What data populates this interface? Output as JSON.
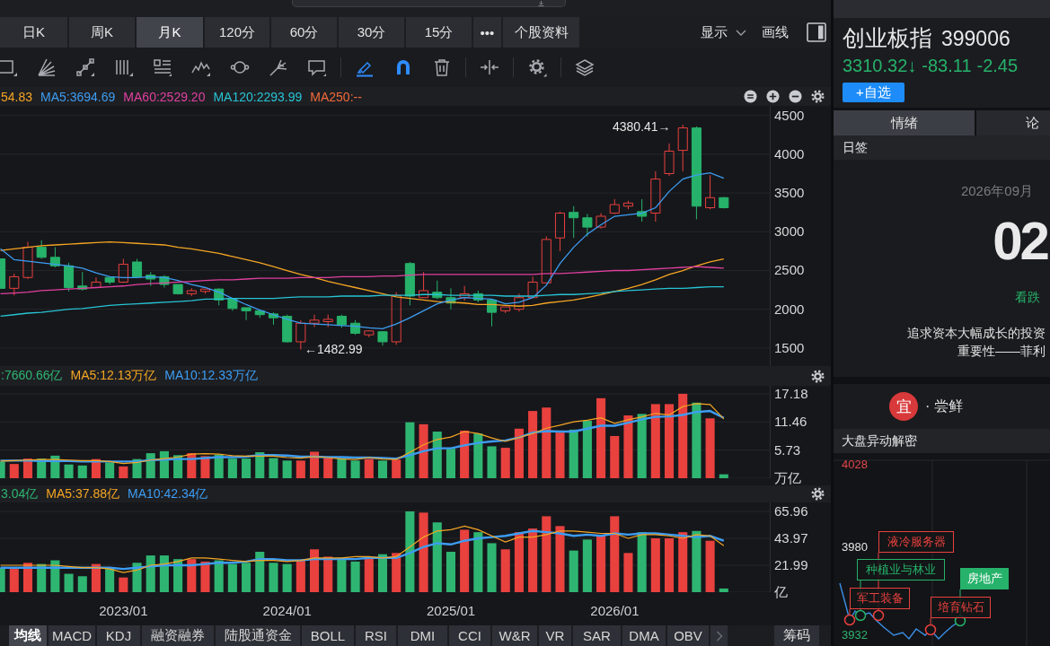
{
  "period_tabs": [
    {
      "label": "日K",
      "selected": false
    },
    {
      "label": "周K",
      "selected": false
    },
    {
      "label": "月K",
      "selected": true
    },
    {
      "label": "120分",
      "selected": false
    },
    {
      "label": "60分",
      "selected": false
    },
    {
      "label": "30分",
      "selected": false
    },
    {
      "label": "15分",
      "selected": false
    },
    {
      "label": "•••",
      "selected": false
    },
    {
      "label": "个股资料",
      "selected": false
    }
  ],
  "view_controls": [
    {
      "label": "显示",
      "kind": "dropdown"
    },
    {
      "label": "画线",
      "kind": "button"
    }
  ],
  "drawing_tools": [
    {
      "kind": "rectangle",
      "active": false
    },
    {
      "kind": "fan",
      "active": false
    },
    {
      "kind": "segment",
      "active": false
    },
    {
      "kind": "cycle_lines",
      "active": false
    },
    {
      "kind": "text_lines",
      "active": false
    },
    {
      "kind": "wave",
      "active": false
    },
    {
      "kind": "ellipse",
      "active": false
    },
    {
      "kind": "pitchfork",
      "active": false
    },
    {
      "kind": "note",
      "active": false
    },
    {
      "kind": "highlighter",
      "active": true
    },
    {
      "kind": "magnet",
      "active": true
    },
    {
      "kind": "delete",
      "active": false
    },
    {
      "kind": "measure",
      "active": false
    },
    {
      "kind": "settings",
      "active": false
    },
    {
      "kind": "layers",
      "active": false
    }
  ],
  "price_chart": {
    "chart_data": {
      "type": "candlestick",
      "categories": [
        null,
        null,
        null,
        null,
        null,
        null,
        null,
        null,
        null,
        null,
        null,
        null,
        null,
        null,
        null,
        null,
        null,
        null,
        null,
        null,
        null,
        null,
        null,
        null,
        null,
        null,
        null,
        null,
        null,
        null,
        null,
        null,
        null,
        null,
        null,
        null,
        null,
        null,
        null,
        null,
        null,
        null,
        null,
        null,
        null,
        null,
        null,
        null,
        null,
        null,
        null,
        null,
        null,
        null
      ],
      "ohlc": [
        [
          2650,
          2650,
          2270,
          2270
        ],
        [
          2270,
          2460,
          2180,
          2420
        ],
        [
          2410,
          2870,
          2390,
          2800
        ],
        [
          2800,
          2890,
          2650,
          2670
        ],
        [
          2670,
          2800,
          2540,
          2560
        ],
        [
          2560,
          2600,
          2230,
          2280
        ],
        [
          2300,
          2480,
          2240,
          2260
        ],
        [
          2280,
          2410,
          2280,
          2350
        ],
        [
          2410,
          2410,
          2320,
          2350
        ],
        [
          2350,
          2650,
          2340,
          2580
        ],
        [
          2610,
          2650,
          2420,
          2420
        ],
        [
          2440,
          2480,
          2300,
          2390
        ],
        [
          2420,
          2440,
          2280,
          2320
        ],
        [
          2320,
          2320,
          2190,
          2200
        ],
        [
          2200,
          2270,
          2170,
          2240
        ],
        [
          2230,
          2260,
          2200,
          2260
        ],
        [
          2260,
          2270,
          2050,
          2120
        ],
        [
          2130,
          2130,
          1980,
          2010
        ],
        [
          2020,
          2020,
          1860,
          1980
        ],
        [
          1980,
          1980,
          1890,
          1930
        ],
        [
          1940,
          1960,
          1800,
          1890
        ],
        [
          1910,
          1930,
          1570,
          1580
        ],
        [
          1580,
          1860,
          1480,
          1820
        ],
        [
          1820,
          1930,
          1770,
          1860
        ],
        [
          1840,
          1930,
          1770,
          1870
        ],
        [
          1910,
          1930,
          1760,
          1800
        ],
        [
          1820,
          1860,
          1670,
          1690
        ],
        [
          1670,
          1730,
          1640,
          1720
        ],
        [
          1710,
          1720,
          1530,
          1580
        ],
        [
          1580,
          2220,
          1540,
          2180
        ],
        [
          2590,
          2610,
          2050,
          2170
        ],
        [
          2150,
          2480,
          2150,
          2240
        ],
        [
          2220,
          2370,
          2130,
          2150
        ],
        [
          2150,
          2270,
          2000,
          2080
        ],
        [
          2150,
          2300,
          2110,
          2200
        ],
        [
          2200,
          2240,
          2090,
          2120
        ],
        [
          2120,
          2120,
          1780,
          1960
        ],
        [
          1980,
          2030,
          1950,
          2030
        ],
        [
          2000,
          2200,
          1970,
          2150
        ],
        [
          2150,
          2420,
          2150,
          2350
        ],
        [
          2340,
          2940,
          2340,
          2900
        ],
        [
          2920,
          3260,
          2750,
          3240
        ],
        [
          3250,
          3330,
          2920,
          3180
        ],
        [
          3180,
          3230,
          2940,
          3060
        ],
        [
          3060,
          3240,
          3040,
          3200
        ],
        [
          3240,
          3420,
          3230,
          3350
        ],
        [
          3330,
          3400,
          3290,
          3370
        ],
        [
          3260,
          3420,
          3130,
          3200
        ],
        [
          3240,
          3780,
          3130,
          3680
        ],
        [
          3750,
          4140,
          3720,
          4040
        ],
        [
          4050,
          4380,
          3780,
          4340
        ],
        [
          4340,
          4360,
          3160,
          3330
        ],
        [
          3310,
          3730,
          3290,
          3440
        ],
        [
          3440,
          3450,
          3300,
          3310
        ]
      ],
      "series": [
        {
          "name": "54.83",
          "type": "line",
          "color": "#f5a623",
          "values": [
            2760,
            2780,
            2800,
            2820,
            2830,
            2840,
            2850,
            2860,
            2870,
            2860,
            2850,
            2840,
            2830,
            2800,
            2780,
            2750,
            2720,
            2680,
            2640,
            2600,
            2550,
            2500,
            2450,
            2410,
            2360,
            2320,
            2280,
            2240,
            2200,
            2160,
            2140,
            2120,
            2100,
            2090,
            2080,
            2060,
            2060,
            2050,
            2040,
            2050,
            2080,
            2100,
            2120,
            2150,
            2190,
            2230,
            2270,
            2320,
            2380,
            2450,
            2500,
            2560,
            2610,
            2650
          ]
        },
        {
          "name": "MA5:3694.69",
          "type": "line",
          "color": "#3d9df2",
          "values": [
            2780,
            2640,
            2620,
            2600,
            2580,
            2560,
            2530,
            2470,
            2420,
            2410,
            2410,
            2420,
            2410,
            2370,
            2320,
            2280,
            2220,
            2140,
            2060,
            1990,
            1930,
            1870,
            1820,
            1810,
            1800,
            1790,
            1780,
            1760,
            1750,
            1810,
            1890,
            1980,
            2070,
            2120,
            2150,
            2140,
            2130,
            2070,
            2090,
            2150,
            2310,
            2590,
            2800,
            2970,
            3090,
            3200,
            3220,
            3240,
            3310,
            3520,
            3680,
            3730,
            3760,
            3690
          ]
        },
        {
          "name": "MA60:2529.20",
          "type": "line",
          "color": "#e0409f",
          "values": [
            2200,
            2210,
            2220,
            2240,
            2250,
            2260,
            2270,
            2280,
            2290,
            2300,
            2320,
            2330,
            2340,
            2350,
            2360,
            2370,
            2380,
            2380,
            2390,
            2400,
            2400,
            2400,
            2410,
            2410,
            2410,
            2420,
            2420,
            2420,
            2430,
            2430,
            2440,
            2450,
            2450,
            2450,
            2450,
            2450,
            2450,
            2450,
            2450,
            2450,
            2460,
            2460,
            2470,
            2480,
            2490,
            2500,
            2500,
            2510,
            2520,
            2530,
            2540,
            2550,
            2540,
            2530
          ]
        },
        {
          "name": "MA120:2293.99",
          "type": "line",
          "color": "#27c4d4",
          "values": [
            1910,
            1930,
            1950,
            1960,
            1980,
            2000,
            2010,
            2030,
            2050,
            2060,
            2070,
            2080,
            2090,
            2100,
            2110,
            2130,
            2130,
            2140,
            2140,
            2140,
            2140,
            2150,
            2160,
            2160,
            2160,
            2170,
            2170,
            2170,
            2180,
            2180,
            2180,
            2190,
            2190,
            2180,
            2180,
            2180,
            2180,
            2170,
            2170,
            2170,
            2180,
            2190,
            2190,
            2200,
            2210,
            2230,
            2240,
            2250,
            2260,
            2270,
            2270,
            2280,
            2290,
            2290
          ]
        },
        {
          "name": "MA250:--",
          "type": "line",
          "color": "#f26b3a",
          "values": [
            null,
            null,
            null,
            null,
            null,
            null,
            null,
            null,
            null,
            null,
            null,
            null,
            null,
            null,
            null,
            null,
            null,
            null,
            null,
            null,
            null,
            null,
            null,
            null,
            null,
            null,
            null,
            null,
            null,
            null,
            null,
            null,
            null,
            null,
            null,
            null,
            null,
            null,
            null,
            null,
            null,
            null,
            null,
            null,
            null,
            null,
            null,
            null,
            null,
            null,
            null,
            null,
            null,
            null
          ]
        }
      ],
      "ylim": [
        1267,
        4624
      ],
      "yticks": [
        4500,
        4000,
        3500,
        3000,
        2500,
        2000,
        1500
      ],
      "grid": true,
      "annotations": [
        "4380.41→",
        "←1482.99"
      ]
    }
  },
  "turnover_chart": {
    "chart_data": {
      "type": "bar",
      "stacked": true,
      "categories": [
        null,
        null,
        null,
        null,
        null,
        null,
        null,
        null,
        null,
        null,
        null,
        null,
        null,
        null,
        null,
        null,
        null,
        null,
        null,
        null,
        null,
        null,
        null,
        null,
        null,
        null,
        null,
        null,
        null,
        null,
        null,
        null,
        null,
        null,
        null,
        null,
        null,
        null,
        null,
        null,
        null,
        null,
        null,
        null,
        null,
        null,
        null,
        null,
        null,
        null,
        null,
        null,
        null,
        null
      ],
      "series": [
        {
          "name": ":7660.66亿",
          "color": "#2fb572",
          "values": [
            3.4,
            null,
            null,
            4.0,
            4.6,
            2.8,
            2.6,
            null,
            3.2,
            null,
            3.9,
            5.1,
            5.5,
            4.7,
            null,
            null,
            4.8,
            4.0,
            4.0,
            5.3,
            4.1,
            3.6,
            null,
            null,
            null,
            4.1,
            3.6,
            null,
            3.6,
            null,
            11.4,
            null,
            9.5,
            6.0,
            null,
            9.1,
            6.5,
            null,
            null,
            null,
            null,
            null,
            9.9,
            11.7,
            null,
            null,
            null,
            13.1,
            null,
            null,
            null,
            15.4,
            null,
            0.8
          ]
        },
        {
          "color": "#e8413e",
          "values": [
            null,
            2.9,
            4.0,
            null,
            null,
            null,
            null,
            3.9,
            null,
            2.4,
            null,
            null,
            null,
            null,
            5.1,
            4.5,
            null,
            null,
            null,
            null,
            null,
            null,
            3.6,
            5.4,
            4.1,
            null,
            null,
            3.9,
            null,
            3.8,
            null,
            11.0,
            null,
            null,
            9.7,
            null,
            null,
            6.2,
            10.1,
            13.7,
            14.4,
            9.3,
            null,
            null,
            16.3,
            8.6,
            12.8,
            null,
            15.1,
            15.1,
            17.2,
            null,
            12.2,
            null
          ]
        },
        {
          "name": "MA5:12.13万亿",
          "type": "line",
          "color": "#f5a623",
          "values": [
            3.5,
            3.6,
            3.7,
            3.8,
            3.8,
            3.7,
            3.6,
            3.6,
            3.4,
            3.0,
            3.2,
            3.7,
            4.0,
            4.3,
            4.9,
            5.0,
            4.9,
            4.6,
            4.5,
            4.5,
            4.5,
            4.2,
            4.1,
            4.4,
            4.2,
            3.9,
            3.8,
            4.2,
            3.9,
            3.8,
            5.3,
            6.8,
            7.9,
            8.4,
            9.5,
            9.1,
            8.2,
            7.5,
            8.3,
            9.1,
            10.2,
            10.8,
            11.5,
            11.8,
            12.3,
            11.2,
            11.9,
            12.5,
            13.2,
            12.9,
            14.6,
            15.2,
            15.0,
            12.1
          ]
        },
        {
          "name": "MA10:12.33万亿",
          "type": "line",
          "color": "#3d9df2",
          "values": [
            3.6,
            3.6,
            3.6,
            3.5,
            3.5,
            3.5,
            3.4,
            3.4,
            3.4,
            3.4,
            3.4,
            3.7,
            3.8,
            3.9,
            3.9,
            4.1,
            4.3,
            4.3,
            4.4,
            4.7,
            4.7,
            4.6,
            4.4,
            4.4,
            4.3,
            4.3,
            4.2,
            4.2,
            4.1,
            4.0,
            4.7,
            5.5,
            6.1,
            6.1,
            6.7,
            7.2,
            7.5,
            7.7,
            8.3,
            9.3,
            9.6,
            9.5,
            9.5,
            10.1,
            10.7,
            10.7,
            11.3,
            12.0,
            12.5,
            12.6,
            12.9,
            13.5,
            13.7,
            12.3
          ]
        }
      ],
      "ylim": [
        0,
        18.83
      ],
      "yticks": [
        17.18,
        11.46,
        5.73,
        {
          "value": 0,
          "label": "万亿"
        }
      ],
      "grid": true
    }
  },
  "volume_chart": {
    "chart_data": {
      "type": "bar",
      "stacked": true,
      "categories": [
        null,
        null,
        null,
        null,
        null,
        null,
        null,
        null,
        null,
        "2023/01",
        null,
        null,
        null,
        null,
        null,
        null,
        null,
        null,
        null,
        null,
        null,
        "2024/01",
        null,
        null,
        null,
        null,
        null,
        null,
        null,
        null,
        null,
        null,
        null,
        "2025/01",
        null,
        null,
        null,
        null,
        null,
        null,
        null,
        null,
        null,
        null,
        null,
        "2026/01",
        null,
        null,
        null,
        null,
        null,
        null,
        null,
        null
      ],
      "series": [
        {
          "name": "3.04亿",
          "color": "#2fb572",
          "values": [
            20,
            null,
            null,
            23,
            26,
            15,
            13,
            null,
            19,
            null,
            24,
            30,
            30,
            27,
            null,
            null,
            26,
            23,
            24,
            33,
            24,
            23,
            null,
            null,
            null,
            28,
            25,
            null,
            31,
            null,
            66,
            null,
            57,
            33,
            null,
            49,
            40,
            null,
            null,
            null,
            null,
            null,
            34,
            43,
            null,
            null,
            null,
            49,
            null,
            null,
            null,
            50,
            null,
            3
          ]
        },
        {
          "color": "#e8413e",
          "values": [
            null,
            19,
            24,
            null,
            null,
            null,
            null,
            23,
            null,
            12,
            null,
            null,
            null,
            null,
            27,
            25,
            null,
            null,
            null,
            null,
            null,
            null,
            26,
            35,
            29,
            null,
            null,
            28,
            null,
            32,
            null,
            65,
            null,
            null,
            51,
            null,
            null,
            35,
            49,
            52,
            62,
            54,
            null,
            null,
            47,
            62,
            32,
            null,
            44,
            44,
            49,
            null,
            42,
            null
          ]
        },
        {
          "name": "MA5:37.88亿",
          "type": "line",
          "color": "#f5a623",
          "values": [
            22,
            22,
            22,
            22,
            22,
            21,
            20,
            20,
            19,
            16,
            18,
            22,
            23,
            25,
            28,
            28,
            27,
            26,
            25,
            26,
            26,
            25,
            26,
            28,
            28,
            28,
            29,
            29,
            28,
            29,
            37,
            45,
            50,
            51,
            54,
            51,
            46,
            41,
            45,
            45,
            47,
            50,
            50,
            49,
            48,
            48,
            44,
            47,
            47,
            46,
            44,
            47,
            46,
            38
          ]
        },
        {
          "name": "MA10:42.34亿",
          "type": "line",
          "color": "#3d9df2",
          "values": [
            20,
            20,
            20,
            20,
            20,
            20,
            20,
            20,
            20,
            19,
            20,
            21,
            22,
            22,
            22,
            23,
            24,
            24,
            25,
            27,
            27,
            26,
            26,
            27,
            27,
            27,
            27,
            28,
            28,
            28,
            32,
            37,
            40,
            39,
            42,
            44,
            45,
            46,
            48,
            50,
            49,
            48,
            46,
            47,
            46,
            48,
            47,
            48,
            48,
            47,
            46,
            45,
            46,
            42
          ]
        }
      ],
      "ylim": [
        0,
        73.29
      ],
      "yticks": [
        65.96,
        43.97,
        21.99,
        {
          "value": 0,
          "label": "亿"
        }
      ],
      "grid": true
    }
  },
  "indicator_tabs": [
    {
      "label": "均线",
      "selected": true
    },
    {
      "label": "MACD",
      "selected": false
    },
    {
      "label": "KDJ",
      "selected": false
    },
    {
      "label": "融资融券",
      "selected": false
    },
    {
      "label": "陆股通资金",
      "selected": false
    },
    {
      "label": "BOLL",
      "selected": false
    },
    {
      "label": "RSI",
      "selected": false
    },
    {
      "label": "DMI",
      "selected": false
    },
    {
      "label": "CCI",
      "selected": false
    },
    {
      "label": "W&R",
      "selected": false
    },
    {
      "label": "VR",
      "selected": false
    },
    {
      "label": "SAR",
      "selected": false
    },
    {
      "label": "DMA",
      "selected": false
    },
    {
      "label": "OBV",
      "selected": false
    }
  ],
  "chips_button": "筹码",
  "quote": {
    "name": "创业板指",
    "code": "399006",
    "price": "3310.32↓",
    "change": "-83.11",
    "change_pct": "-2.45",
    "rising": false,
    "watchlist_button": "+自选"
  },
  "side_tabs": [
    {
      "label": "情绪",
      "selected": true
    },
    {
      "label": "论",
      "selected": false
    }
  ],
  "daily_card": {
    "title": "日签",
    "date": "2026年09月",
    "day": "02",
    "sentiment": {
      "label": "看跌",
      "rising": false
    },
    "quote_lines": [
      "追求资本大幅成长的投资",
      "重要性——菲利"
    ]
  },
  "advice": {
    "badge": "宜",
    "text": "· 尝鲜"
  },
  "market_moves": {
    "title": "大盘异动解密",
    "levels": [
      {
        "text": "4028",
        "kind": "high"
      },
      {
        "text": "3980",
        "kind": "mid"
      },
      {
        "text": "3932",
        "kind": "low"
      }
    ],
    "tags": [
      {
        "label": "液冷服务器",
        "rising": true,
        "highlighted": false
      },
      {
        "label": "种植业与林业",
        "rising": false,
        "highlighted": false
      },
      {
        "label": "军工装备",
        "rising": true,
        "highlighted": false
      },
      {
        "label": "房地产",
        "rising": false,
        "highlighted": true
      },
      {
        "label": "培育钻石",
        "rising": true,
        "highlighted": false
      }
    ]
  }
}
